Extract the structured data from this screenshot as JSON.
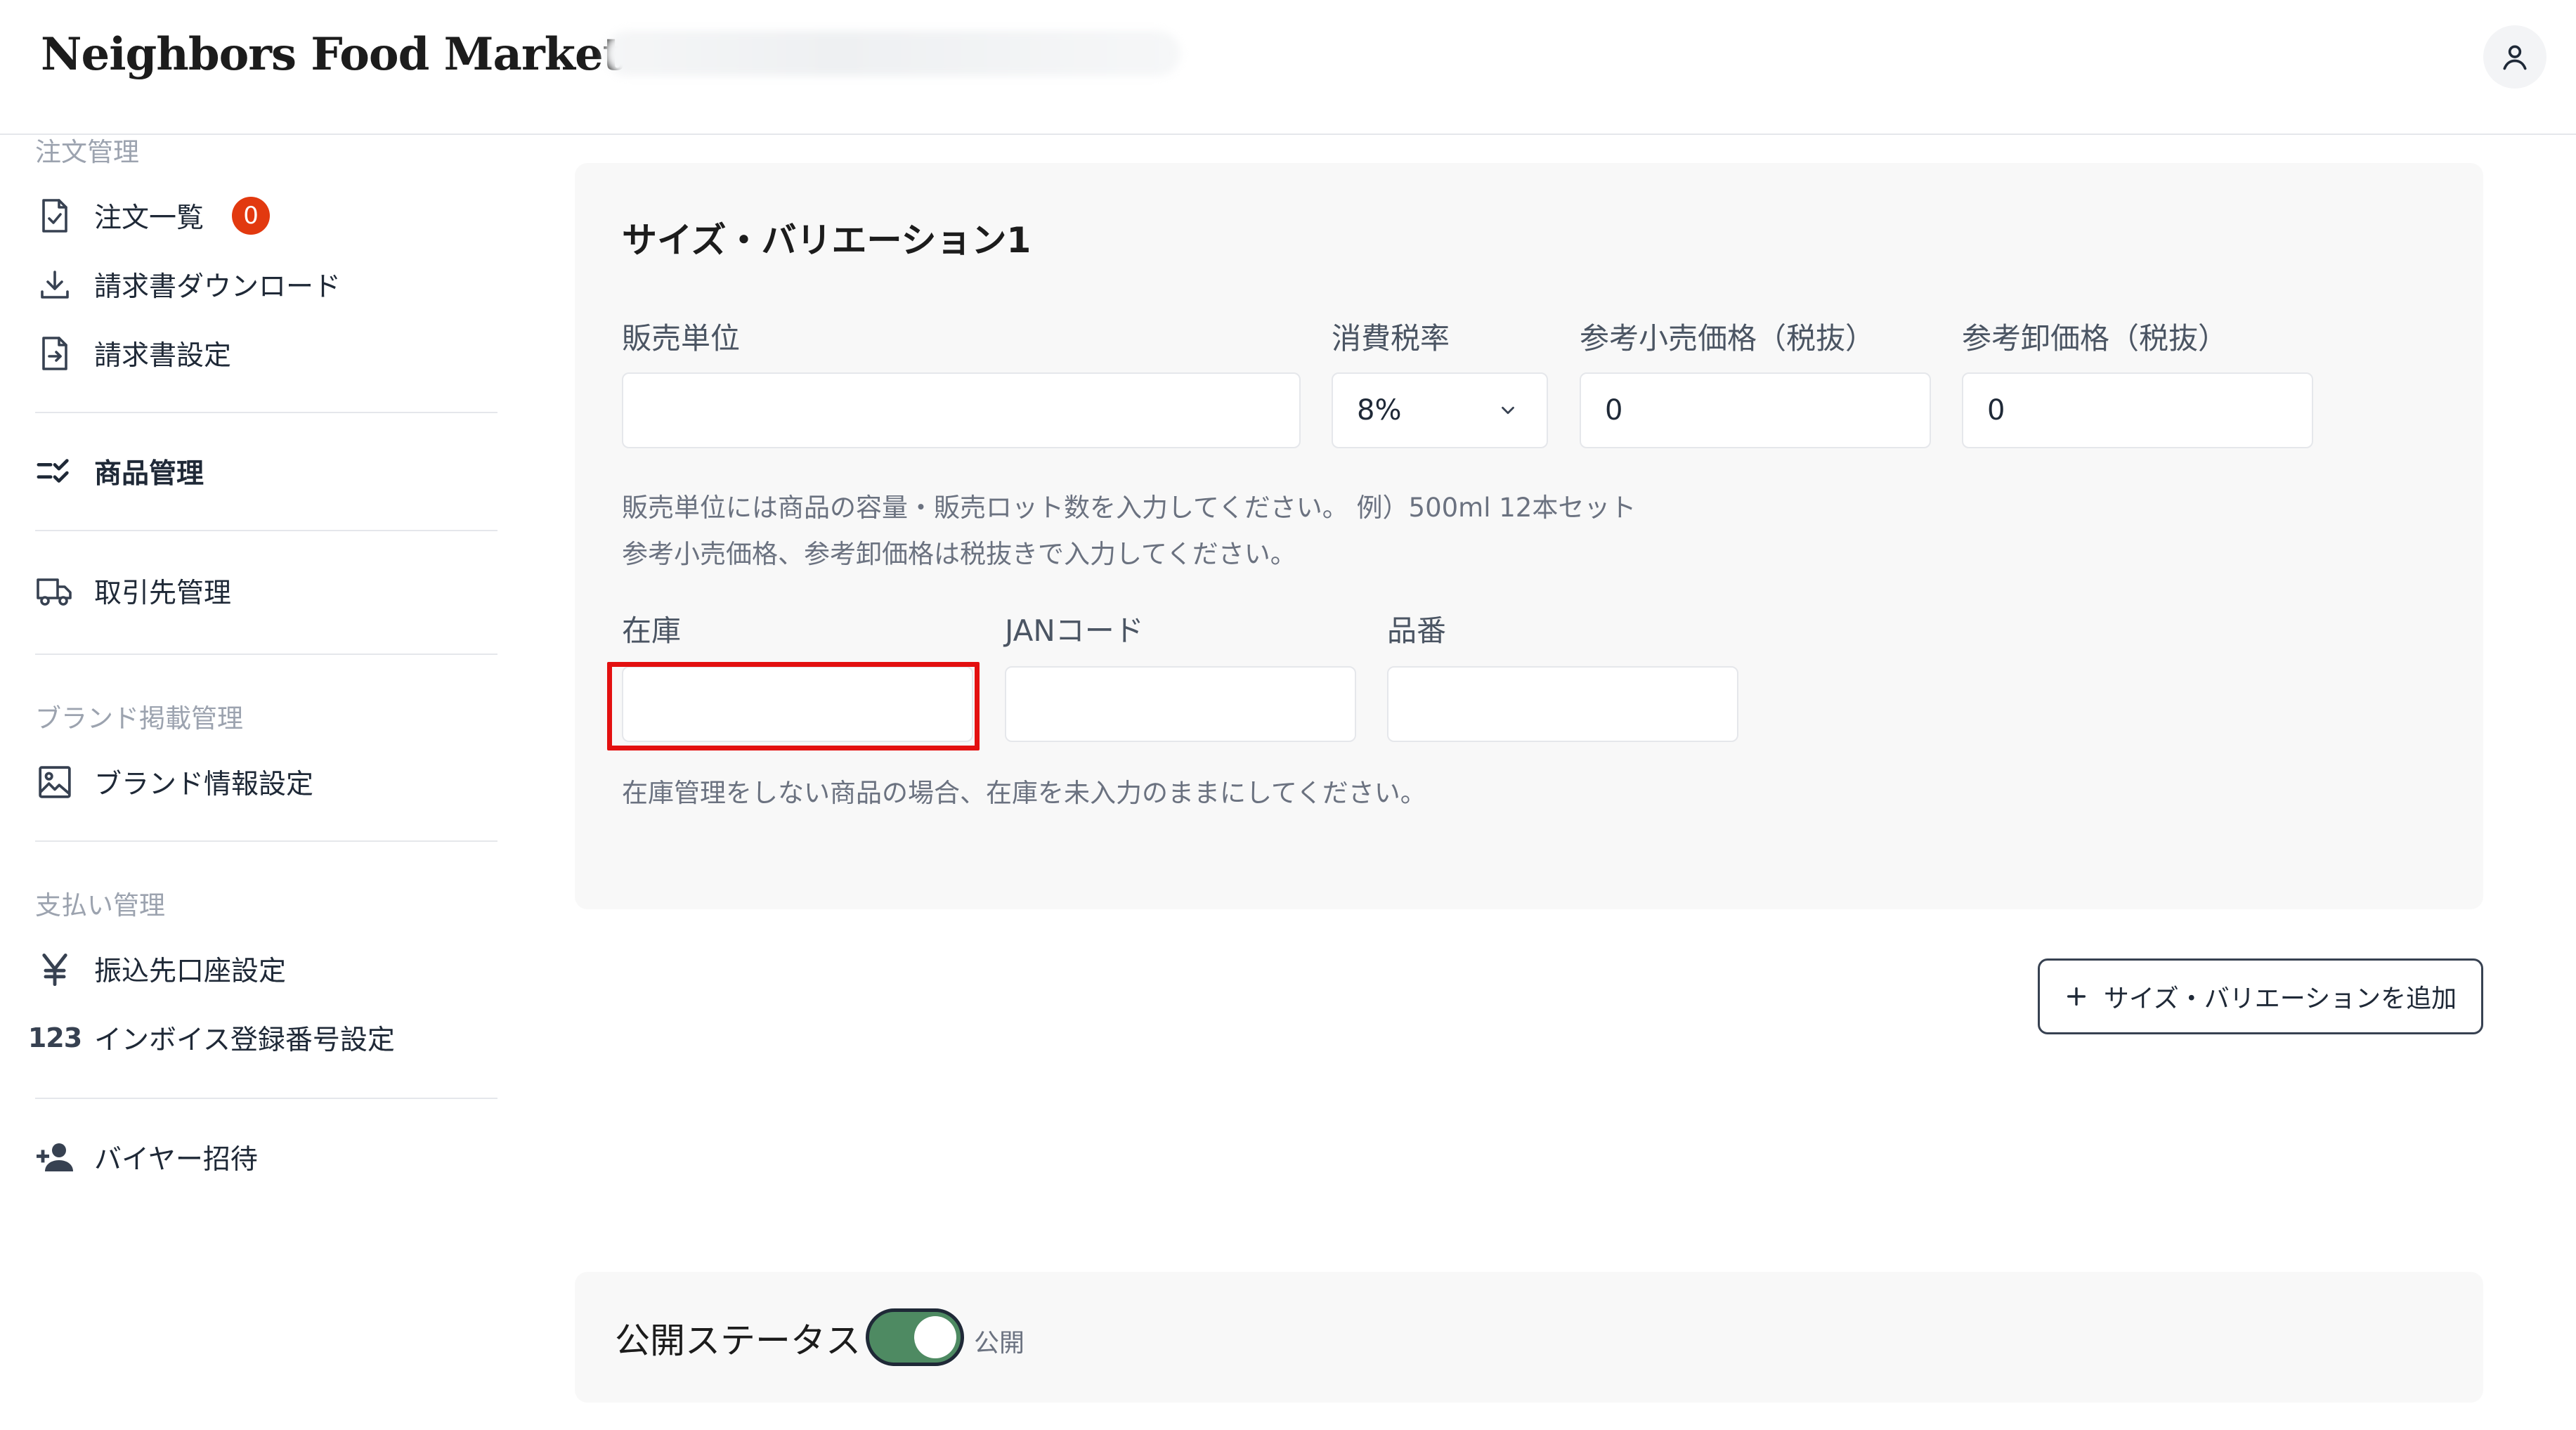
{
  "header": {
    "brand": "Neighbors Food Market",
    "account_icon": "user-icon"
  },
  "sidebar": {
    "section_orders": "注文管理",
    "order_list": "注文一覧",
    "order_badge": "0",
    "invoice_download": "請求書ダウンロード",
    "invoice_settings": "請求書設定",
    "product_management": "商品管理",
    "customer_management": "取引先管理",
    "section_brand": "ブランド掲載管理",
    "brand_info": "ブランド情報設定",
    "section_payment": "支払い管理",
    "bank_account": "振込先口座設定",
    "invoice_number_icon_text": "123",
    "invoice_number": "インボイス登録番号設定",
    "buyer_invite": "バイヤー招待"
  },
  "variation": {
    "title": "サイズ・バリエーション1",
    "sales_unit_label": "販売単位",
    "sales_unit_value": "",
    "tax_rate_label": "消費税率",
    "tax_rate_value": "8%",
    "retail_price_label": "参考小売価格（税抜）",
    "retail_price_value": "0",
    "wholesale_price_label": "参考卸価格（税抜）",
    "wholesale_price_value": "0",
    "hint_line1": "販売単位には商品の容量・販売ロット数を入力してください。 例）500ml 12本セット",
    "hint_line2": "参考小売価格、参考卸価格は税抜きで入力してください。",
    "stock_label": "在庫",
    "stock_value": "",
    "jan_label": "JANコード",
    "jan_value": "",
    "sku_label": "品番",
    "sku_value": "",
    "stock_hint": "在庫管理をしない商品の場合、在庫を未入力のままにしてください。"
  },
  "add_variation_button": "サイズ・バリエーションを追加",
  "status": {
    "label": "公開ステータス",
    "toggle_text": "公開",
    "toggle_on": true,
    "toggle_color": "#4e8a62"
  },
  "colors": {
    "badge": "#e2390f",
    "highlight": "#e31010"
  }
}
